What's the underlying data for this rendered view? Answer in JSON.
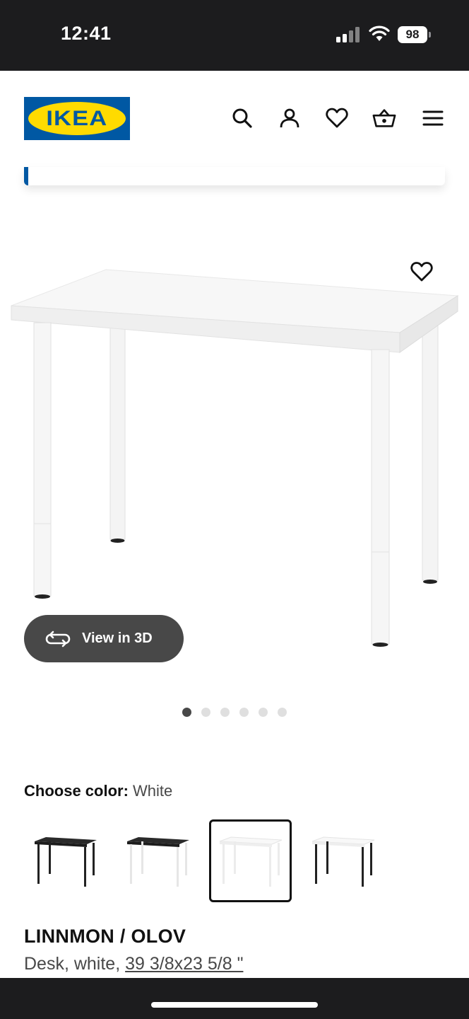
{
  "status_bar": {
    "time": "12:41",
    "battery": "98"
  },
  "header": {
    "logo_text": "IKEA",
    "icons": [
      "search-icon",
      "account-icon",
      "heart-icon",
      "basket-icon",
      "menu-icon"
    ]
  },
  "gallery": {
    "view_3d_label": "View in 3D",
    "dot_count": 6,
    "active_dot": 1
  },
  "color_chooser": {
    "label": "Choose color:",
    "selected_value": "White",
    "swatches": [
      {
        "top": "black-brown",
        "legs": "black"
      },
      {
        "top": "black-brown",
        "legs": "white"
      },
      {
        "top": "white",
        "legs": "white"
      },
      {
        "top": "white",
        "legs": "black"
      }
    ],
    "selected_index": 2
  },
  "product": {
    "name": "LINNMON / OLOV",
    "description_prefix": "Desk, white, ",
    "size_link": "39 3/8x23 5/8 \""
  },
  "colors": {
    "ikea_blue": "#0058a3",
    "ikea_yellow": "#ffdb00",
    "button_dark": "#484848"
  }
}
